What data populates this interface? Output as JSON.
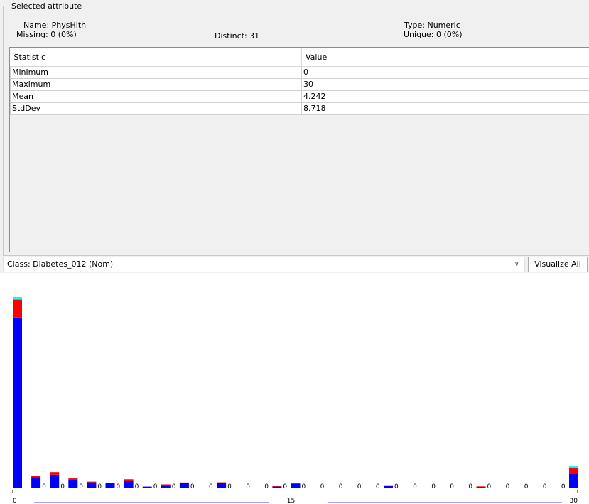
{
  "panel": {
    "legend": "Selected attribute",
    "name": "Name: PhysHlth",
    "missing": "Missing: 0 (0%)",
    "distinct": "Distinct: 31",
    "type": "Type: Numeric",
    "unique": "Unique: 0 (0%)"
  },
  "stats": {
    "headers": [
      "Statistic",
      "Value"
    ],
    "rows": [
      [
        "Minimum",
        "0"
      ],
      [
        "Maximum",
        "30"
      ],
      [
        "Mean",
        "4.242"
      ],
      [
        "StdDev",
        "8.718"
      ]
    ]
  },
  "class_selector": {
    "value": "Class: Diabetes_012 (Nom)",
    "icon": "chevron-down-icon"
  },
  "visualize_all_label": "Visualize All",
  "chart_data": {
    "type": "bar",
    "stacked": true,
    "x_ticks": [
      "0",
      "15",
      "30"
    ],
    "series_colors": [
      "#0000ff",
      "#ff0000",
      "#00ffff"
    ],
    "bars": [
      {
        "x": 0,
        "counts": [
          100,
          10.5,
          1.5
        ],
        "label": ""
      },
      {
        "x": 1,
        "counts": [
          6.5,
          1,
          0
        ],
        "label": "0"
      },
      {
        "x": 2,
        "counts": [
          8,
          1.5,
          0
        ],
        "label": "0"
      },
      {
        "x": 3,
        "counts": [
          5,
          0.8,
          0
        ],
        "label": "0"
      },
      {
        "x": 4,
        "counts": [
          3.5,
          0.4,
          0
        ],
        "label": "0"
      },
      {
        "x": 5,
        "counts": [
          3,
          0.3,
          0
        ],
        "label": "0"
      },
      {
        "x": 6,
        "counts": [
          4.5,
          0.8,
          0
        ],
        "label": "0"
      },
      {
        "x": 7,
        "counts": [
          1,
          0,
          0
        ],
        "label": "0"
      },
      {
        "x": 8,
        "counts": [
          2,
          0.3,
          0
        ],
        "label": "0"
      },
      {
        "x": 9,
        "counts": [
          3,
          0.4,
          0
        ],
        "label": "0"
      },
      {
        "x": 10,
        "counts": [
          0.3,
          0,
          0
        ],
        "label": "0"
      },
      {
        "x": 11,
        "counts": [
          3,
          0.5,
          0
        ],
        "label": "0"
      },
      {
        "x": 12,
        "counts": [
          0.3,
          0,
          0
        ],
        "label": "0"
      },
      {
        "x": 13,
        "counts": [
          0.3,
          0,
          0
        ],
        "label": "0"
      },
      {
        "x": 14,
        "counts": [
          1,
          0.3,
          0
        ],
        "label": "0"
      },
      {
        "x": 15,
        "counts": [
          2.5,
          0.8,
          0
        ],
        "label": "0"
      },
      {
        "x": 16,
        "counts": [
          0,
          0,
          0
        ],
        "label": "0"
      },
      {
        "x": 17,
        "counts": [
          0,
          0,
          0
        ],
        "label": "0"
      },
      {
        "x": 18,
        "counts": [
          0,
          0,
          0
        ],
        "label": "0"
      },
      {
        "x": 19,
        "counts": [
          0,
          0,
          0
        ],
        "label": "0"
      },
      {
        "x": 20,
        "counts": [
          1.5,
          0.3,
          0
        ],
        "label": "0"
      },
      {
        "x": 21,
        "counts": [
          0.3,
          0,
          0
        ],
        "label": "0"
      },
      {
        "x": 22,
        "counts": [
          0,
          0,
          0
        ],
        "label": "0"
      },
      {
        "x": 23,
        "counts": [
          0,
          0,
          0
        ],
        "label": "0"
      },
      {
        "x": 24,
        "counts": [
          0,
          0,
          0
        ],
        "label": "0"
      },
      {
        "x": 25,
        "counts": [
          0.8,
          0.3,
          0
        ],
        "label": "0"
      },
      {
        "x": 26,
        "counts": [
          0,
          0,
          0
        ],
        "label": "0"
      },
      {
        "x": 27,
        "counts": [
          0,
          0,
          0
        ],
        "label": "0"
      },
      {
        "x": 28,
        "counts": [
          0.3,
          0,
          0
        ],
        "label": "0"
      },
      {
        "x": 29,
        "counts": [
          0,
          0,
          0
        ],
        "label": "0"
      },
      {
        "x": 30,
        "counts": [
          8.5,
          3.5,
          1
        ],
        "label": ""
      }
    ]
  }
}
